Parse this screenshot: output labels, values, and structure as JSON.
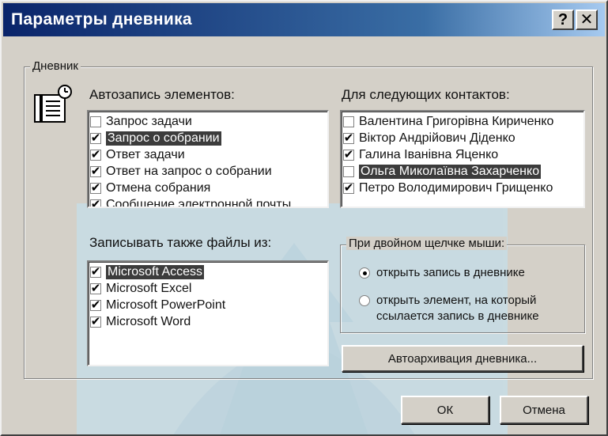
{
  "window": {
    "title": "Параметры дневника",
    "help_glyph": "?",
    "close_glyph": "✕"
  },
  "journal_group": {
    "label": "Дневник"
  },
  "autorecord": {
    "label": "Автозапись элементов:",
    "items": [
      {
        "label": "Запрос задачи",
        "checked": false,
        "selected": false
      },
      {
        "label": "Запрос о собрании",
        "checked": true,
        "selected": true
      },
      {
        "label": "Ответ задачи",
        "checked": true,
        "selected": false
      },
      {
        "label": "Ответ на запрос о собрании",
        "checked": true,
        "selected": false
      },
      {
        "label": "Отмена собрания",
        "checked": true,
        "selected": false
      },
      {
        "label": "Сообщение электронной почты",
        "checked": true,
        "selected": false
      }
    ]
  },
  "contacts": {
    "label": "Для следующих контактов:",
    "items": [
      {
        "label": "Валентина Григорівна Кириченко",
        "checked": false,
        "selected": false
      },
      {
        "label": "Віктор Андрійович Діденко",
        "checked": true,
        "selected": false
      },
      {
        "label": "Галина Іванівна Яценко",
        "checked": true,
        "selected": false
      },
      {
        "label": "Ольга Миколаївна Захарченко",
        "checked": false,
        "selected": true
      },
      {
        "label": "Петро Володимирович Грищенко",
        "checked": true,
        "selected": false
      }
    ]
  },
  "files": {
    "label": "Записывать также файлы из:",
    "items": [
      {
        "label": "Microsoft Access",
        "checked": true,
        "selected": true
      },
      {
        "label": "Microsoft Excel",
        "checked": true,
        "selected": false
      },
      {
        "label": "Microsoft PowerPoint",
        "checked": true,
        "selected": false
      },
      {
        "label": "Microsoft Word",
        "checked": true,
        "selected": false
      }
    ]
  },
  "double_click": {
    "label": "При двойном щелчке мыши:",
    "option1": "открыть запись в дневнике",
    "option2_line1": "открыть элемент, на который",
    "option2_line2": "ссылается запись в дневнике",
    "selected": 1
  },
  "buttons": {
    "autoarchive": "Автоархивация дневника...",
    "ok": "ОК",
    "cancel": "Отмена"
  }
}
